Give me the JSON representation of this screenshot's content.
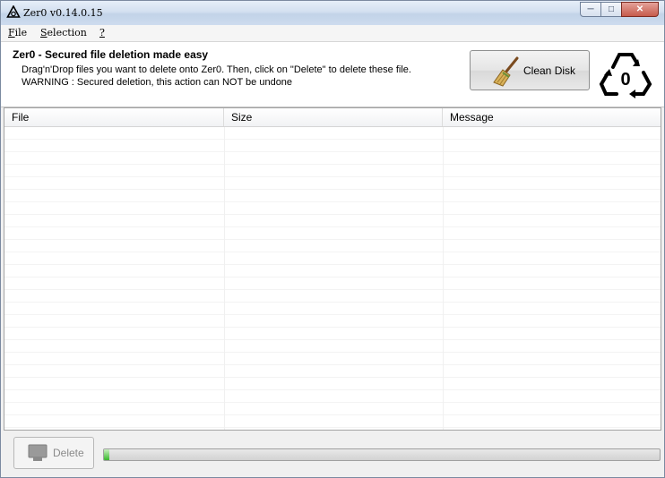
{
  "window": {
    "title": "Zer0 v0.14.0.15"
  },
  "menu": [
    {
      "label": "File",
      "underline": "F",
      "rest": "ile"
    },
    {
      "label": "Selection",
      "underline": "S",
      "rest": "election"
    },
    {
      "label": "?",
      "underline": "?",
      "rest": ""
    }
  ],
  "header": {
    "title": "Zer0 - Secured file deletion made easy",
    "line1": "Drag'n'Drop files you want to delete onto Zer0. Then, click on \"Delete\" to delete these file.",
    "line2": "WARNING : Secured deletion, this action can NOT be undone"
  },
  "clean_button": {
    "label": "Clean Disk",
    "icon": "broom-icon"
  },
  "logo": {
    "text": "0",
    "icon": "recycle-zero-logo"
  },
  "table": {
    "columns": [
      "File",
      "Size",
      "Message"
    ],
    "rows": []
  },
  "delete_button": {
    "label": "Delete",
    "icon": "delete-icon"
  },
  "progress": {
    "value": 0.01
  },
  "colors": {
    "progress_fill": "#38b82c",
    "title_bar": "#cddbee"
  }
}
